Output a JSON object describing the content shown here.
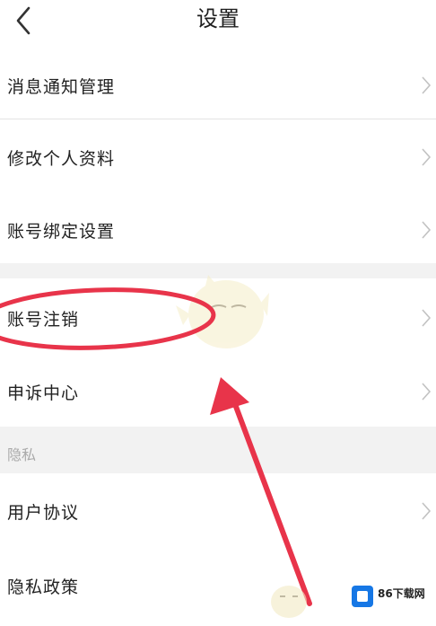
{
  "header": {
    "title": "设置",
    "back_icon": "chevron-left-icon"
  },
  "menu": {
    "notifications": "消息通知管理",
    "edit_profile": "修改个人资料",
    "account_binding": "账号绑定设置",
    "account_cancel": "账号注销",
    "complaint_center": "申诉中心",
    "privacy_section": "隐私",
    "user_agreement": "用户协议",
    "privacy_policy": "隐私政策"
  },
  "watermark": {
    "site": "86下载网"
  },
  "colors": {
    "annotation_red": "#e8344a",
    "logo_blue": "#1677e5",
    "section_bg": "#f2f2f2"
  }
}
